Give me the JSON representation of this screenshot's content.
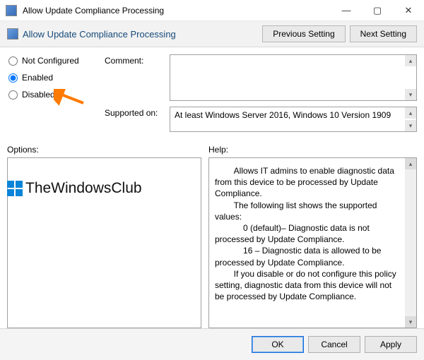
{
  "window": {
    "title": "Allow Update Compliance Processing",
    "buttons": {
      "min": "—",
      "max": "▢",
      "close": "✕"
    }
  },
  "header": {
    "title": "Allow Update Compliance Processing",
    "prev": "Previous Setting",
    "next": "Next Setting"
  },
  "radios": {
    "not_configured": "Not Configured",
    "enabled": "Enabled",
    "disabled": "Disabled",
    "selected": "enabled"
  },
  "fields": {
    "comment_label": "Comment:",
    "comment_value": "",
    "supported_label": "Supported on:",
    "supported_value": "At least Windows Server 2016, Windows 10 Version 1909"
  },
  "columns": {
    "options_label": "Options:",
    "help_label": "Help:"
  },
  "help_body": "        Allows IT admins to enable diagnostic data from this device to be processed by Update Compliance.\n        The following list shows the supported values:\n            0 (default)– Diagnostic data is not processed by Update Compliance.\n            16 – Diagnostic data is allowed to be processed by Update Compliance.\n        If you disable or do not configure this policy setting, diagnostic data from this device will not be processed by Update Compliance.",
  "footer": {
    "ok": "OK",
    "cancel": "Cancel",
    "apply": "Apply"
  },
  "watermark": "TheWindowsClub"
}
